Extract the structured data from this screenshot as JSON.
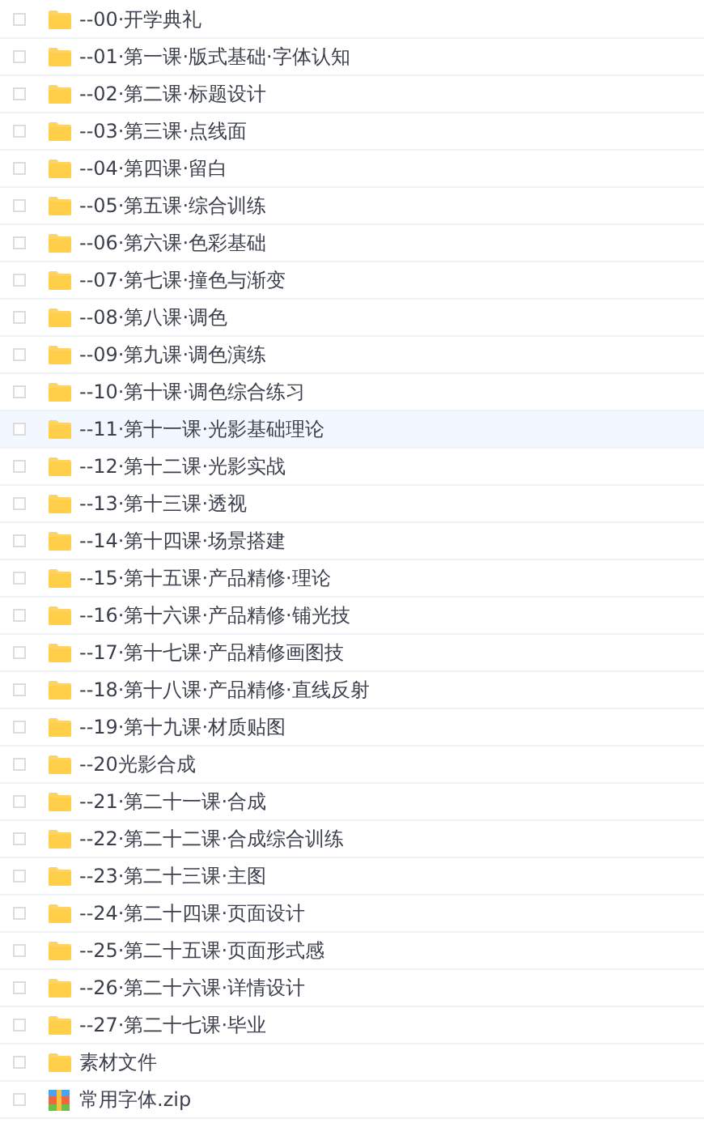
{
  "files": [
    {
      "name": "--00·开学典礼",
      "kind": "folder",
      "checked": false,
      "highlighted": false
    },
    {
      "name": "--01·第一课·版式基础·字体认知",
      "kind": "folder",
      "checked": false,
      "highlighted": false
    },
    {
      "name": "--02·第二课·标题设计",
      "kind": "folder",
      "checked": false,
      "highlighted": false
    },
    {
      "name": "--03·第三课·点线面",
      "kind": "folder",
      "checked": false,
      "highlighted": false
    },
    {
      "name": "--04·第四课·留白",
      "kind": "folder",
      "checked": false,
      "highlighted": false
    },
    {
      "name": "--05·第五课·综合训练",
      "kind": "folder",
      "checked": false,
      "highlighted": false
    },
    {
      "name": "--06·第六课·色彩基础",
      "kind": "folder",
      "checked": false,
      "highlighted": false
    },
    {
      "name": "--07·第七课·撞色与渐变",
      "kind": "folder",
      "checked": false,
      "highlighted": false
    },
    {
      "name": "--08·第八课·调色",
      "kind": "folder",
      "checked": false,
      "highlighted": false
    },
    {
      "name": "--09·第九课·调色演练",
      "kind": "folder",
      "checked": false,
      "highlighted": false
    },
    {
      "name": "--10·第十课·调色综合练习",
      "kind": "folder",
      "checked": false,
      "highlighted": false
    },
    {
      "name": "--11·第十一课·光影基础理论",
      "kind": "folder",
      "checked": false,
      "highlighted": true
    },
    {
      "name": "--12·第十二课·光影实战",
      "kind": "folder",
      "checked": false,
      "highlighted": false
    },
    {
      "name": "--13·第十三课·透视",
      "kind": "folder",
      "checked": false,
      "highlighted": false
    },
    {
      "name": "--14·第十四课·场景搭建",
      "kind": "folder",
      "checked": false,
      "highlighted": false
    },
    {
      "name": "--15·第十五课·产品精修·理论",
      "kind": "folder",
      "checked": false,
      "highlighted": false
    },
    {
      "name": "--16·第十六课·产品精修·铺光技",
      "kind": "folder",
      "checked": false,
      "highlighted": false
    },
    {
      "name": "--17·第十七课·产品精修画图技",
      "kind": "folder",
      "checked": false,
      "highlighted": false
    },
    {
      "name": "--18·第十八课·产品精修·直线反射",
      "kind": "folder",
      "checked": false,
      "highlighted": false
    },
    {
      "name": "--19·第十九课·材质贴图",
      "kind": "folder",
      "checked": false,
      "highlighted": false
    },
    {
      "name": "--20光影合成",
      "kind": "folder",
      "checked": false,
      "highlighted": false
    },
    {
      "name": "--21·第二十一课·合成",
      "kind": "folder",
      "checked": false,
      "highlighted": false
    },
    {
      "name": "--22·第二十二课·合成综合训练",
      "kind": "folder",
      "checked": false,
      "highlighted": false
    },
    {
      "name": "--23·第二十三课·主图",
      "kind": "folder",
      "checked": false,
      "highlighted": false
    },
    {
      "name": "--24·第二十四课·页面设计",
      "kind": "folder",
      "checked": false,
      "highlighted": false
    },
    {
      "name": "--25·第二十五课·页面形式感",
      "kind": "folder",
      "checked": false,
      "highlighted": false
    },
    {
      "name": "--26·第二十六课·详情设计",
      "kind": "folder",
      "checked": false,
      "highlighted": false
    },
    {
      "name": "--27·第二十七课·毕业",
      "kind": "folder",
      "checked": false,
      "highlighted": false
    },
    {
      "name": "素材文件",
      "kind": "folder",
      "checked": false,
      "highlighted": false
    },
    {
      "name": "常用字体.zip",
      "kind": "zip",
      "checked": false,
      "highlighted": false
    }
  ]
}
